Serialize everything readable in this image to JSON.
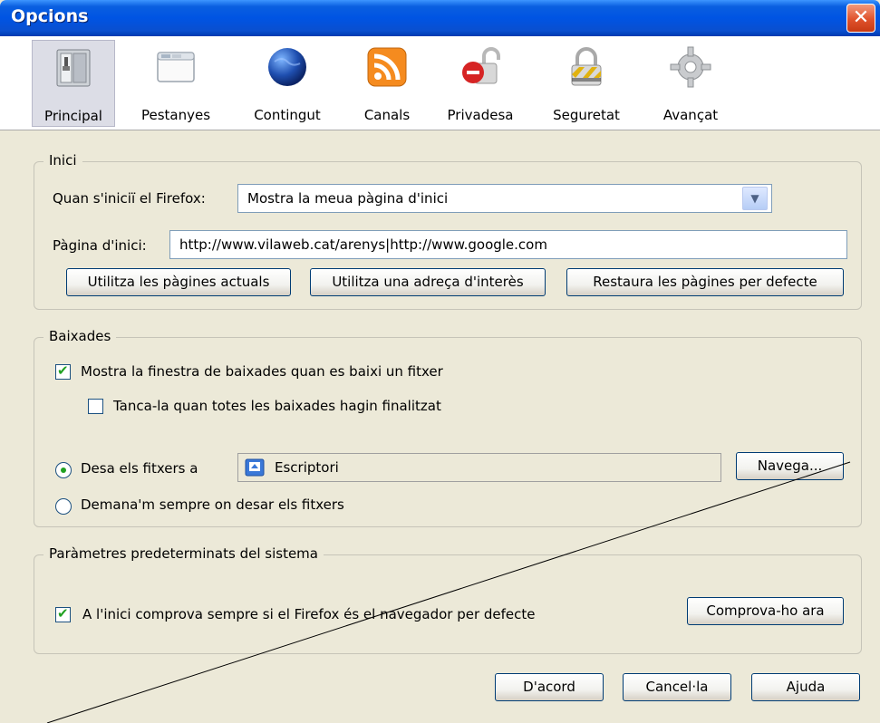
{
  "window": {
    "title": "Opcions",
    "close_glyph": "✕"
  },
  "tabs": [
    {
      "label": "Principal",
      "icon": "switch-panel-icon",
      "selected": true
    },
    {
      "label": "Pestanyes",
      "icon": "window-tabs-icon"
    },
    {
      "label": "Contingut",
      "icon": "globe-icon"
    },
    {
      "label": "Canals",
      "icon": "rss-feed-icon"
    },
    {
      "label": "Privadesa",
      "icon": "privacy-lock-icon"
    },
    {
      "label": "Seguretat",
      "icon": "security-padlock-icon"
    },
    {
      "label": "Avançat",
      "icon": "gear-icon"
    }
  ],
  "inici": {
    "legend": "Inici",
    "startup_label": "Quan s'iniciï el Firefox:",
    "startup_value": "Mostra la meua pàgina d'inici",
    "homepage_label": "Pàgina d'inici:",
    "homepage_value": "http://www.vilaweb.cat/arenys|http://www.google.com",
    "btn_current": "Utilitza les pàgines actuals",
    "btn_bookmark": "Utilitza una adreça d'interès",
    "btn_restore": "Restaura les pàgines per defecte"
  },
  "baixades": {
    "legend": "Baixades",
    "show_window": "Mostra la finestra de baixades quan es baixi un fitxer",
    "close_when_done": "Tanca-la quan totes les baixades hagin finalitzat",
    "save_to": "Desa els fitxers a",
    "folder": "Escriptori",
    "browse": "Navega...",
    "always_ask": "Demana'm sempre on desar els fitxers"
  },
  "sistema": {
    "legend": "Paràmetres predeterminats del sistema",
    "check_default": "A l'inici comprova sempre si el Firefox és el navegador per defecte",
    "check_now": "Comprova-ho ara"
  },
  "footer": {
    "ok": "D'acord",
    "cancel": "Cancel·la",
    "help": "Ajuda"
  },
  "colors": {
    "titlebar": "#0054e3",
    "dialog_bg": "#ece9d8",
    "check_green": "#21a121"
  }
}
